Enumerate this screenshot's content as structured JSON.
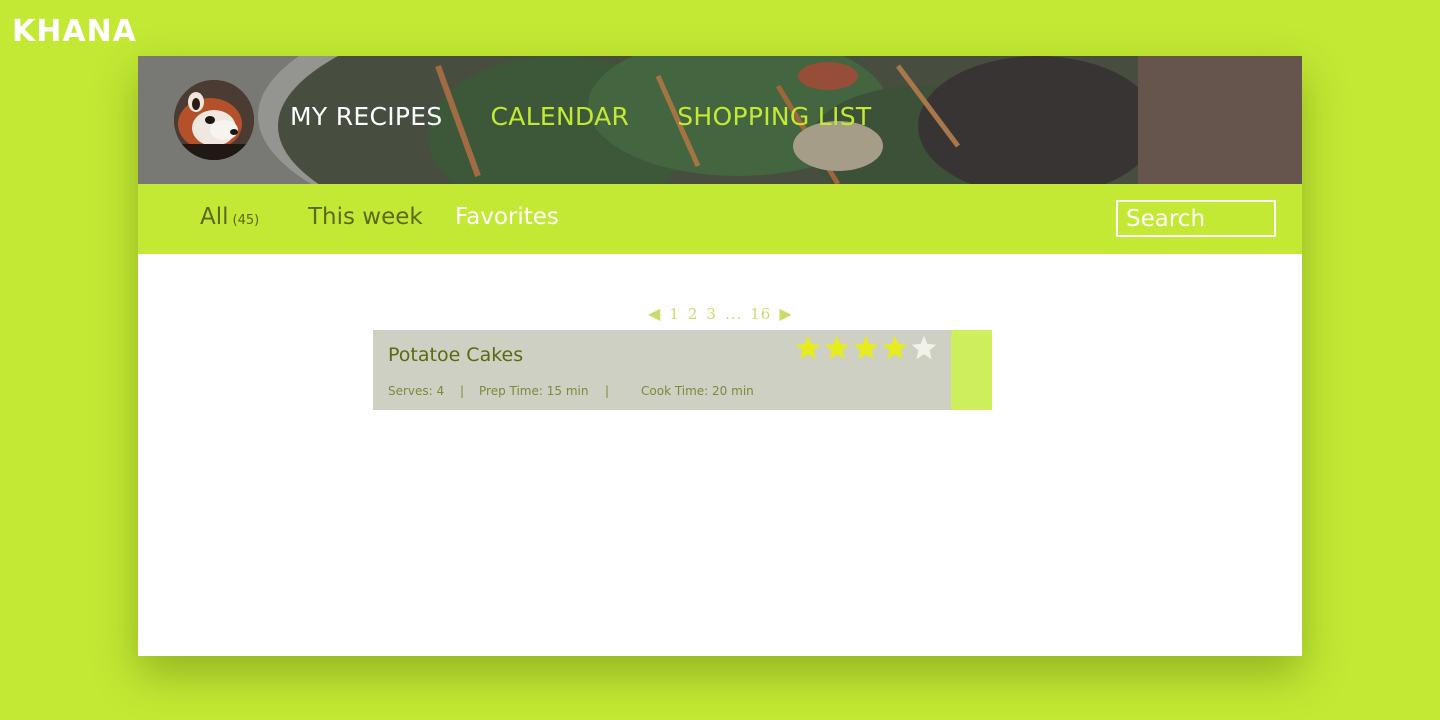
{
  "brand": {
    "logo_text": "KHANA"
  },
  "header": {
    "nav": [
      {
        "label": "MY RECIPES",
        "active": true
      },
      {
        "label": "CALENDAR",
        "active": false
      },
      {
        "label": "SHOPPING LIST",
        "active": false
      }
    ]
  },
  "subnav": {
    "tabs": [
      {
        "label": "All",
        "count": "(45)"
      },
      {
        "label": "This week"
      },
      {
        "label": "Favorites"
      }
    ],
    "search_placeholder": "Search"
  },
  "pagination": {
    "prev_icon": "triangle-left-icon",
    "pages": [
      "1",
      "2",
      "3",
      "..."
    ],
    "last_page": "16",
    "next_icon": "triangle-right-icon"
  },
  "recipes": [
    {
      "title": "Potatoe Cakes",
      "rating": 4,
      "rating_max": 5,
      "serves": "Serves: 4",
      "separator": "|",
      "prep_time": "Prep Time: 15 min",
      "cook_time": "Cook Time: 20 min"
    }
  ],
  "colors": {
    "accent": "#c3e934",
    "star_filled": "#e6ec1d",
    "star_empty": "#f2f2ea",
    "card_bg": "#cdd0c2"
  }
}
